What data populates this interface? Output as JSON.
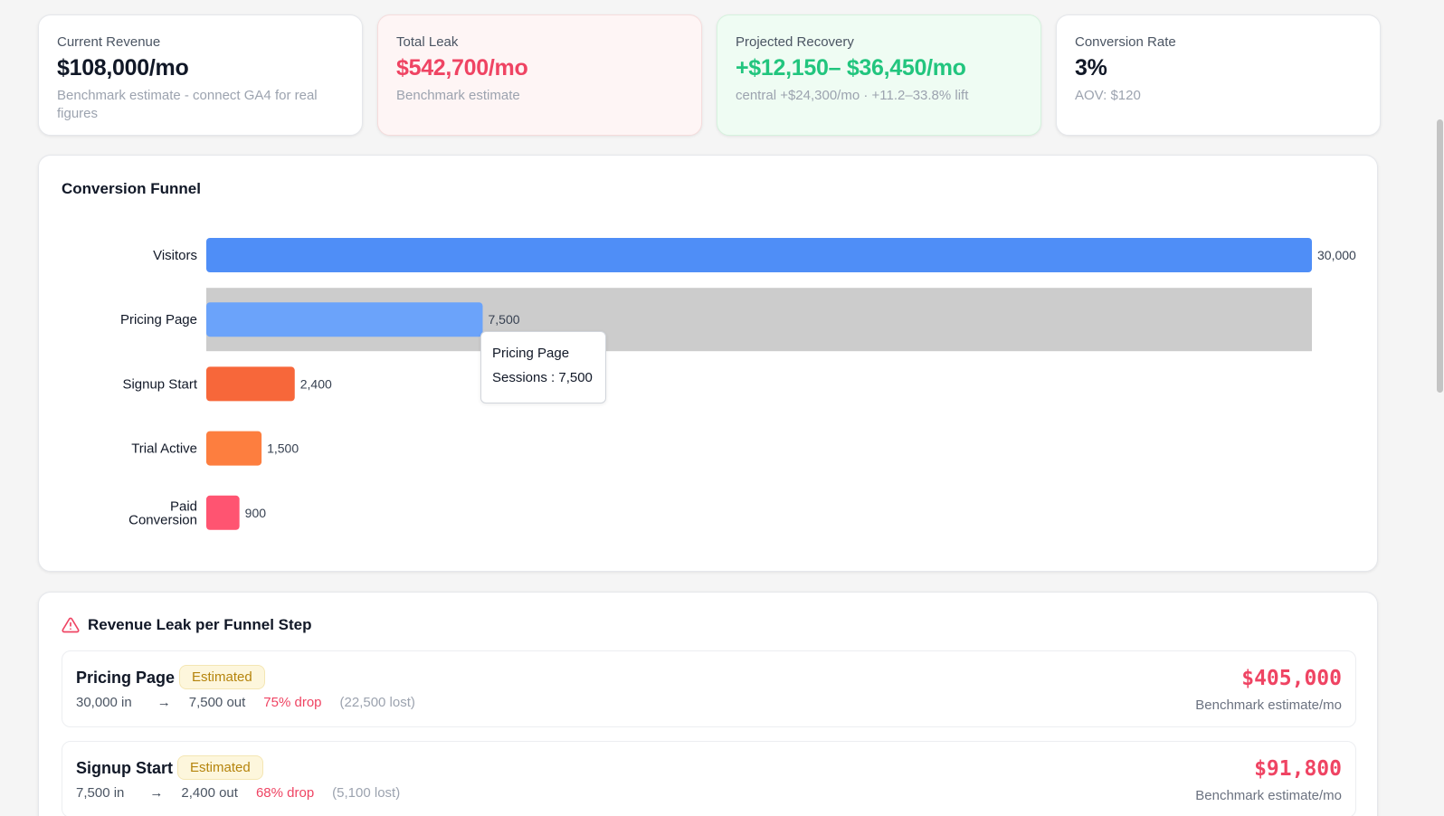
{
  "kpis": [
    {
      "label": "Current Revenue",
      "value": "$108,000/mo",
      "sub": "Benchmark estimate - connect GA4 for real figures",
      "color": "#111827"
    },
    {
      "label": "Total Leak",
      "value": "$542,700/mo",
      "sub": "Benchmark estimate",
      "color": "#ef4463"
    },
    {
      "label": "Projected Recovery",
      "value": "+$12,150– $36,450/mo",
      "sub": "central +$24,300/mo · +11.2–33.8% lift",
      "color": "#22c57e"
    },
    {
      "label": "Conversion Rate",
      "value": "3%",
      "sub": "AOV: $120",
      "color": "#111827"
    }
  ],
  "funnel": {
    "title": "Conversion Funnel",
    "tooltip": {
      "title": "Pricing Page",
      "line": "Sessions : 7,500"
    }
  },
  "chart_data": {
    "type": "bar",
    "orientation": "horizontal",
    "categories": [
      "Visitors",
      "Pricing Page",
      "Signup Start",
      "Trial Active",
      "Paid Conversion"
    ],
    "category_lines": [
      [
        "Visitors"
      ],
      [
        "Pricing Page"
      ],
      [
        "Signup Start"
      ],
      [
        "Trial Active"
      ],
      [
        "Paid",
        "Conversion"
      ]
    ],
    "values": [
      30000,
      7500,
      2400,
      1500,
      900
    ],
    "value_labels": [
      "30,000",
      "7,500",
      "2,400",
      "1,500",
      "900"
    ],
    "colors": [
      "#4f8ef7",
      "#6ba3fa",
      "#f7673a",
      "#fd7e3f",
      "#ff5471"
    ],
    "xlim": [
      0,
      30000
    ],
    "highlighted": "Pricing Page",
    "grid": false
  },
  "leaks": {
    "title": "Revenue Leak per Funnel Step",
    "items": [
      {
        "name": "Pricing Page",
        "badge": "Estimated",
        "in": "30,000 in",
        "out": "7,500 out",
        "drop": "75% drop",
        "lost": "(22,500 lost)",
        "amount": "$405,000",
        "amount_sub": "Benchmark estimate/mo"
      },
      {
        "name": "Signup Start",
        "badge": "Estimated",
        "in": "7,500 in",
        "out": "2,400 out",
        "drop": "68% drop",
        "lost": "(5,100 lost)",
        "amount": "$91,800",
        "amount_sub": "Benchmark estimate/mo"
      }
    ]
  }
}
